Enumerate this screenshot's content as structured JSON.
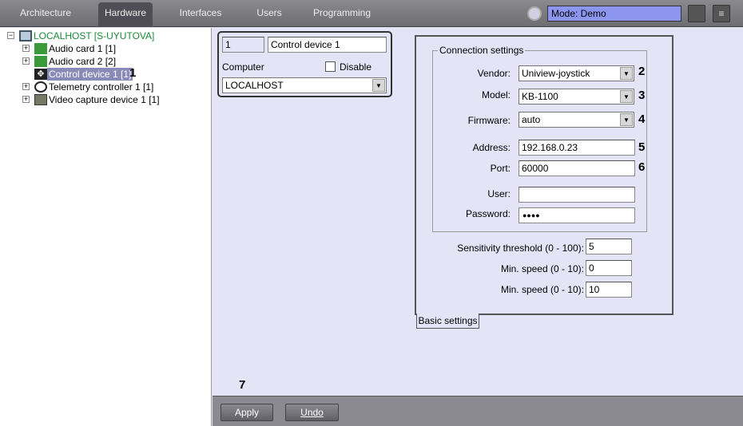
{
  "tabs": [
    {
      "label": "Architecture"
    },
    {
      "label": "Hardware"
    },
    {
      "label": "Interfaces"
    },
    {
      "label": "Users"
    },
    {
      "label": "Programming"
    }
  ],
  "mode": "Mode: Demo",
  "tree": {
    "root": "LOCALHOST [S-UYUTOVA]",
    "items": [
      {
        "label": "Audio card 1 [1]"
      },
      {
        "label": "Audio card 2 [2]"
      },
      {
        "label": "Control device 1 [1]"
      },
      {
        "label": "Telemetry controller 1 [1]"
      },
      {
        "label": "Video capture device 1 [1]"
      }
    ]
  },
  "object": {
    "id": "1",
    "name": "Control device 1",
    "computer_label": "Computer",
    "disable_label": "Disable",
    "computer": "LOCALHOST"
  },
  "connection": {
    "legend": "Connection settings",
    "vendor_label": "Vendor:",
    "vendor": "Uniview-joystick",
    "model_label": "Model:",
    "model": "KB-1100",
    "firmware_label": "Firmware:",
    "firmware": "auto",
    "address_label": "Address:",
    "address": "192.168.0.23",
    "port_label": "Port:",
    "port": "60000",
    "user_label": "User:",
    "user": "",
    "password_label": "Password:",
    "password": "●●●●"
  },
  "sensitivity_label": "Sensitivity threshold (0 - 100):",
  "sensitivity": "5",
  "minspeed_label": "Min. speed (0 - 10):",
  "minspeed": "0",
  "minspeed2_label": "Min. speed (0 - 10):",
  "minspeed2": "10",
  "settings_tab": "Basic settings",
  "callouts": [
    "1",
    "2",
    "3",
    "4",
    "5",
    "6",
    "7"
  ],
  "apply": "Apply",
  "undo": "Undo"
}
